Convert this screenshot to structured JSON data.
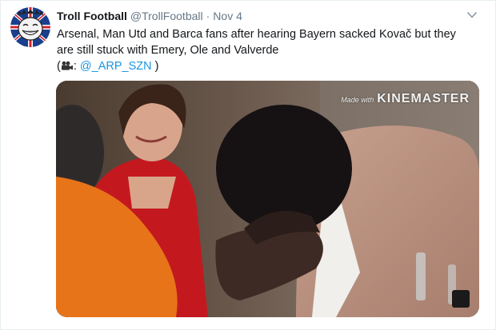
{
  "tweet": {
    "display_name": "Troll Football",
    "handle": "@TrollFootball",
    "separator": "·",
    "time": "Nov 4",
    "text_line1": "Arsenal, Man Utd and Barca fans after hearing Bayern sacked Kovač but they",
    "text_line2": "are still stuck with Emery, Ole and Valverde",
    "credit_open": "(",
    "credit_colon": ":",
    "credit_mention": "@_ARP_SZN",
    "credit_close": ")"
  },
  "media": {
    "watermark_small": "Made with",
    "watermark_big": "KINEMASTER"
  },
  "icons": {
    "avatar": "troll-face-union-jack-avatar",
    "caret": "chevron-down-icon",
    "camera": "movie-camera-icon"
  },
  "colors": {
    "link": "#1b95e0",
    "secondary_text": "#657786",
    "primary_text": "#14171a"
  }
}
